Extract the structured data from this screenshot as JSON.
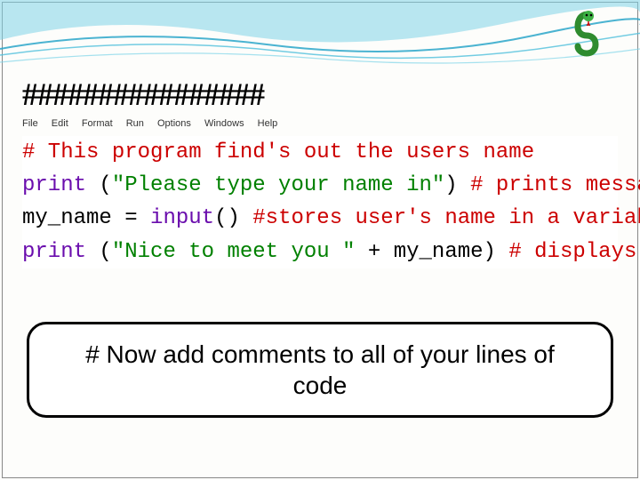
{
  "title_hashes": "################",
  "menu": {
    "items": [
      "File",
      "Edit",
      "Format",
      "Run",
      "Options",
      "Windows",
      "Help"
    ]
  },
  "code": {
    "line1": {
      "comment": "# This program find's out the users name"
    },
    "line2": {
      "func": "print",
      "space": " ",
      "paren_open": "(",
      "string": "\"Please type your name in\"",
      "paren_close": ")",
      "trailing_space": " ",
      "comment": "# prints message to user"
    },
    "line3": {
      "var": "my_name",
      "eq": " = ",
      "func": "input",
      "parens": "()",
      "space": " ",
      "comment": "#stores user's name in a variable"
    },
    "line4": {
      "func": "print",
      "space": " ",
      "paren_open": "(",
      "string": "\"Nice to meet you \"",
      "plus": " + ",
      "var": "my_name",
      "paren_close": ")",
      "trailing_space": " ",
      "comment": "# displays message"
    }
  },
  "callout": "# Now add comments to all of your lines of code",
  "icons": {
    "snake": "snake-icon"
  }
}
